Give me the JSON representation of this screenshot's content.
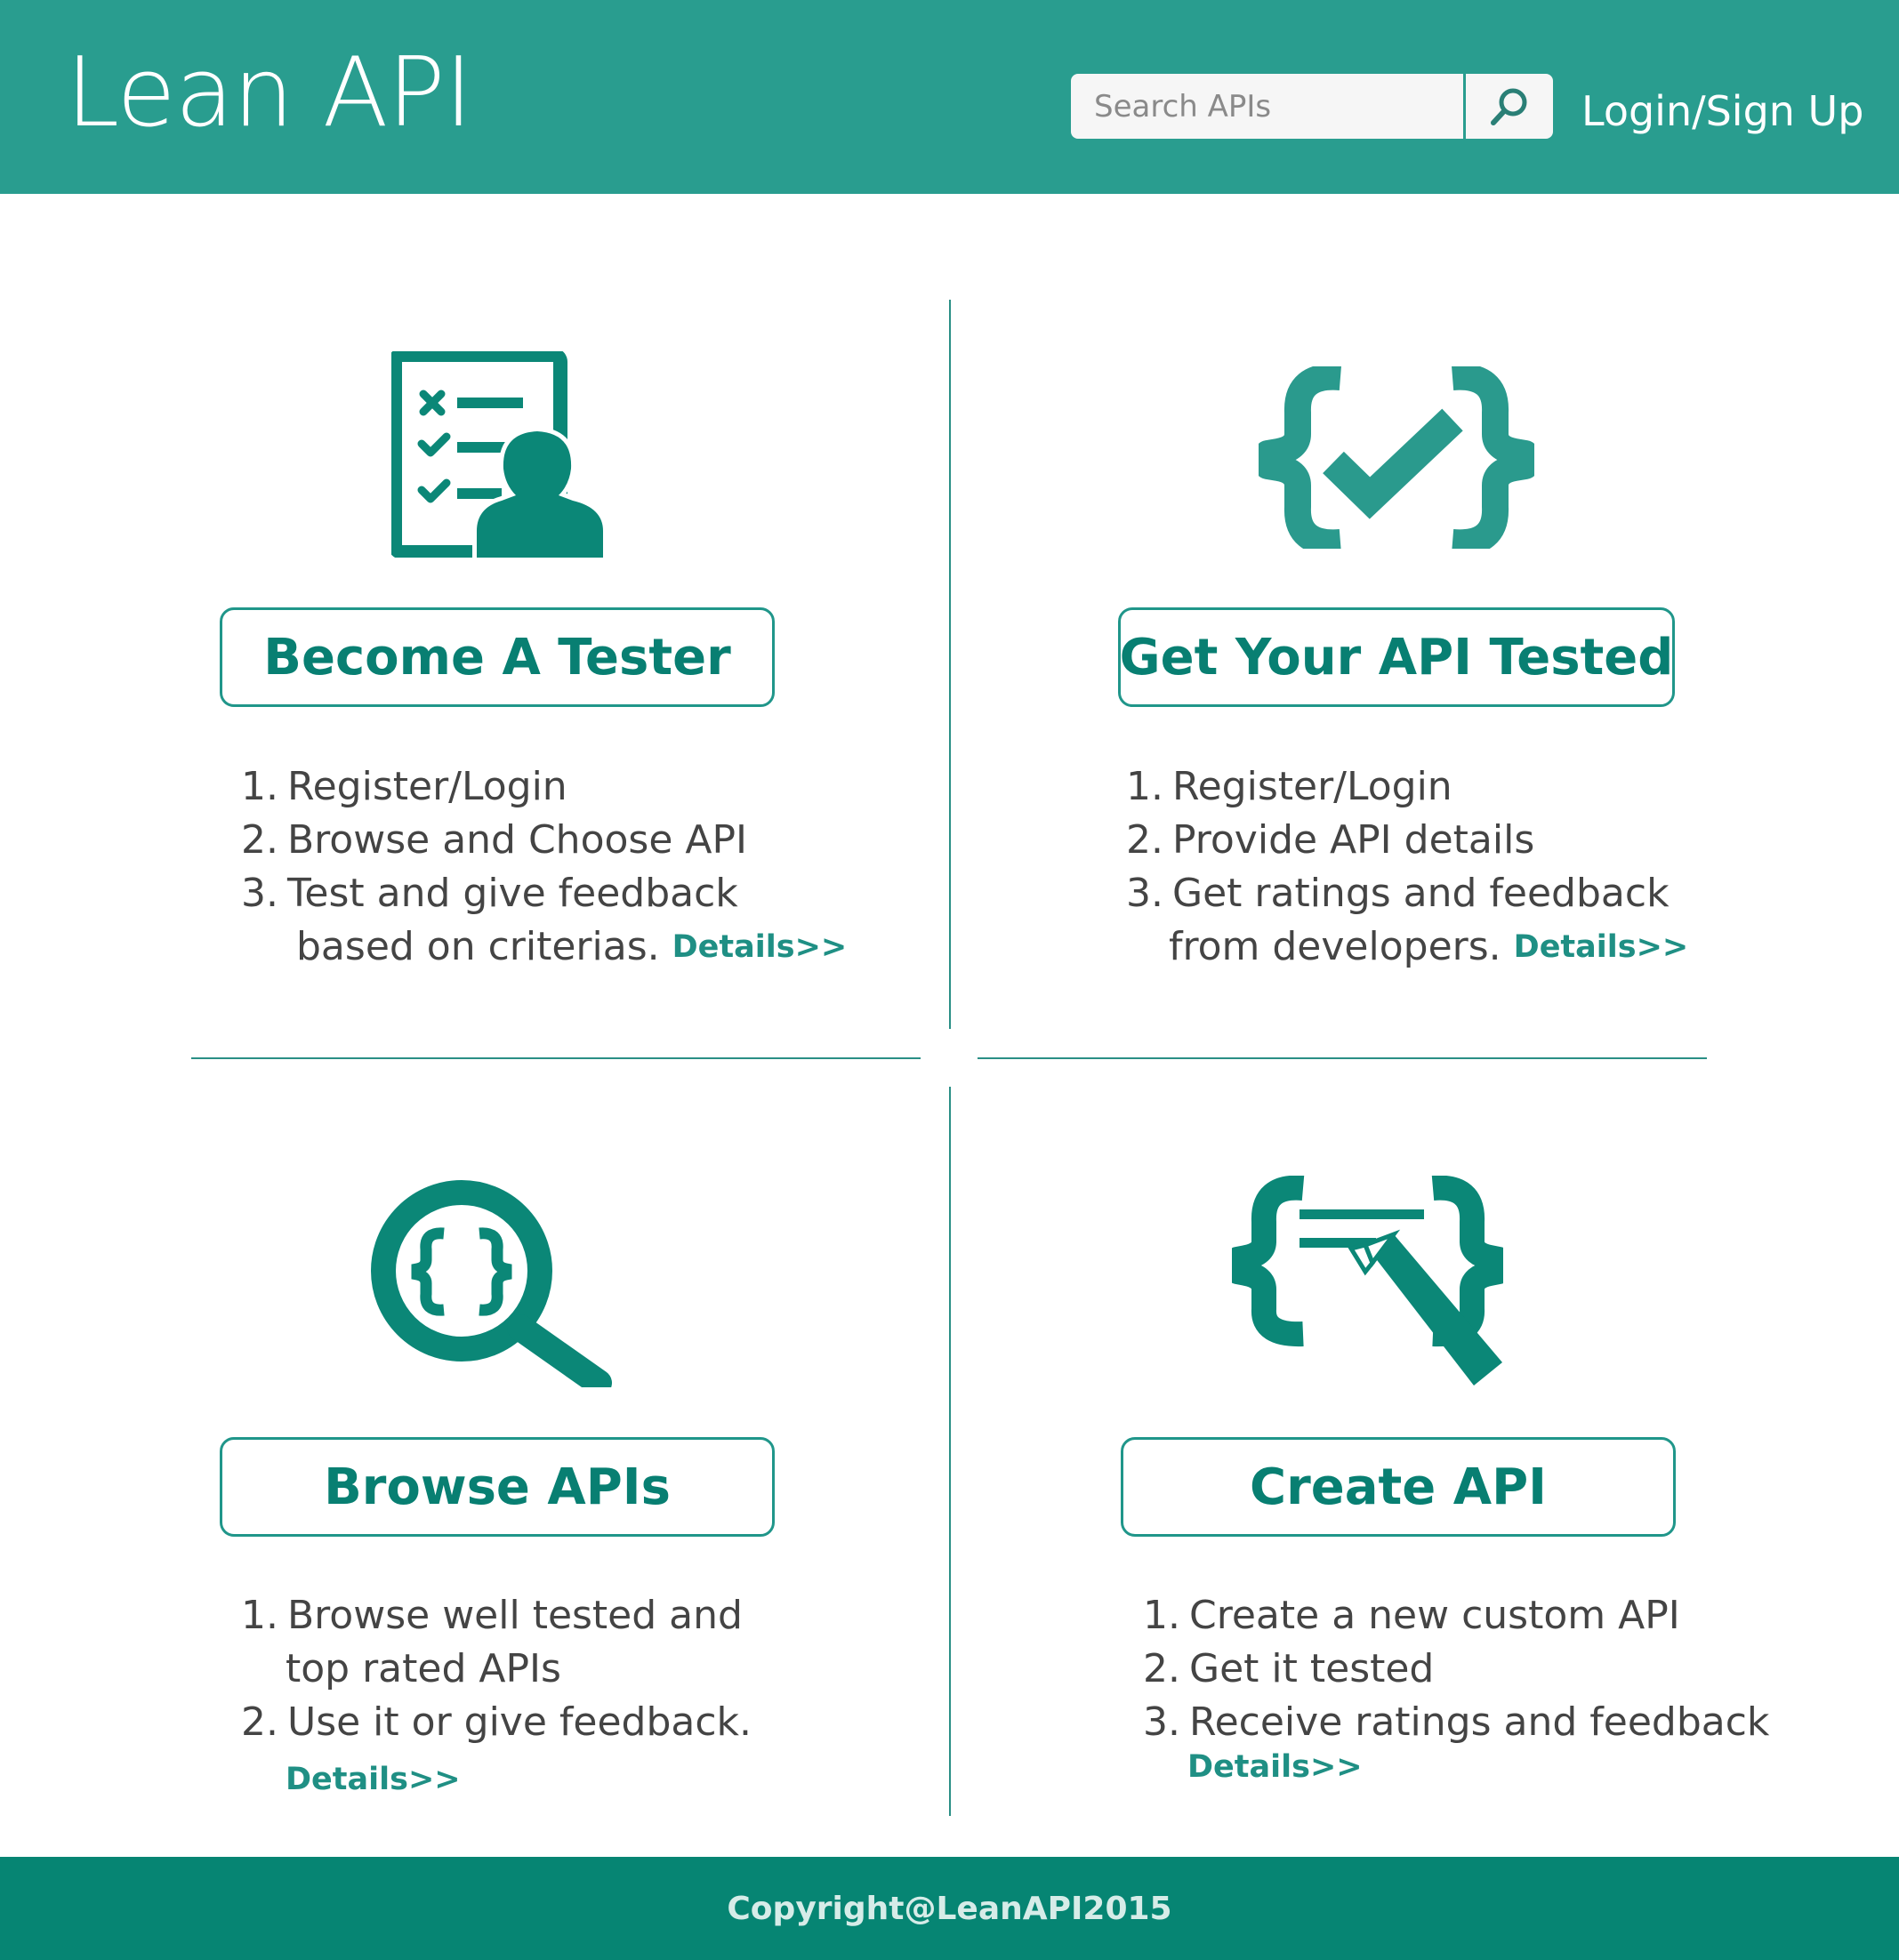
{
  "header": {
    "brand": "Lean API",
    "search_placeholder": "Search APIs",
    "login_label": "Login/Sign Up"
  },
  "sections": {
    "tester": {
      "button": "Become A Tester",
      "steps": [
        "1.",
        "Register/Login",
        "2.",
        "Browse and Choose API",
        "3.",
        "Test and give feedback",
        "based on criterias."
      ],
      "details": "Details>>"
    },
    "get_tested": {
      "button": "Get Your API Tested",
      "steps": [
        "1.",
        "Register/Login",
        "2.",
        "Provide API details",
        "3.",
        "Get ratings and feedback",
        "from developers."
      ],
      "details": "Details>>"
    },
    "browse": {
      "button": "Browse APIs",
      "steps": [
        "1.",
        "Browse well tested and",
        "top rated APIs",
        "2.",
        "Use it or give feedback."
      ],
      "details": "Details>>"
    },
    "create": {
      "button": "Create API",
      "steps": [
        "1.",
        "Create a new custom API",
        "2.",
        "Get it tested",
        "3.",
        "Receive ratings and feedback"
      ],
      "details": "Details>>"
    }
  },
  "icons": {
    "tester": "checklist-person-icon",
    "get_tested": "code-check-icon",
    "browse": "magnifier-code-icon",
    "create": "code-pencil-icon",
    "search": "search-icon"
  },
  "footer": {
    "copyright": "Copyright@LeanAPI2015"
  },
  "colors": {
    "brand_teal": "#299d8f",
    "dark_teal": "#087f72",
    "footer": "#068573",
    "text": "#444444"
  }
}
